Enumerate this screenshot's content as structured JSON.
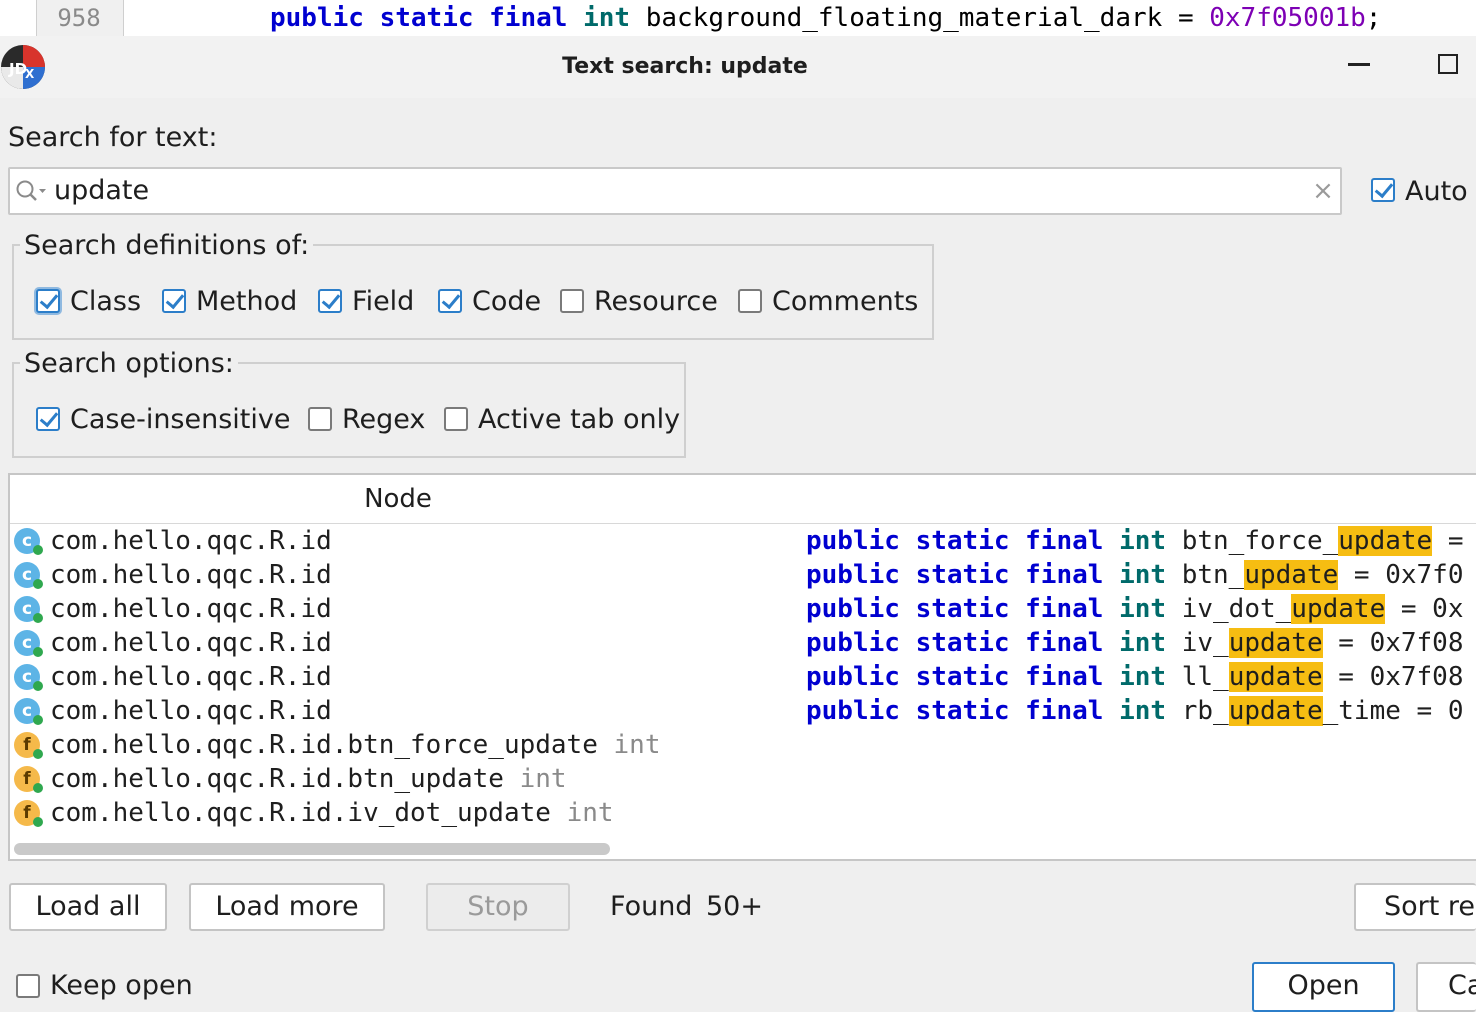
{
  "background_editor": {
    "line_number": "958",
    "code": {
      "kw1": "public",
      "kw2": "static",
      "kw3": "final",
      "type": "int",
      "name": "background_floating_material_dark",
      "eq": "=",
      "value": "0x7f05001b",
      "semi": ";"
    }
  },
  "window": {
    "title": "Text search: update"
  },
  "search": {
    "label": "Search for text:",
    "value": "update",
    "clear_glyph": "×",
    "auto_search_label": "Auto s",
    "auto_search_checked": true
  },
  "definitions": {
    "legend": "Search definitions of:",
    "items": [
      {
        "label": "Class",
        "checked": true
      },
      {
        "label": "Method",
        "checked": true
      },
      {
        "label": "Field",
        "checked": true
      },
      {
        "label": "Code",
        "checked": true
      },
      {
        "label": "Resource",
        "checked": false
      },
      {
        "label": "Comments",
        "checked": false
      }
    ]
  },
  "options": {
    "legend": "Search options:",
    "items": [
      {
        "label": "Case-insensitive",
        "checked": true
      },
      {
        "label": "Regex",
        "checked": false
      },
      {
        "label": "Active tab only",
        "checked": false
      }
    ]
  },
  "results": {
    "columns": [
      "Node",
      ""
    ],
    "rows": [
      {
        "icon": "class-icon",
        "letter": "c",
        "node": "com.hello.qqc.R.id",
        "type": "",
        "code": {
          "pre": "btn_force_",
          "match": "update",
          "post": " ="
        }
      },
      {
        "icon": "class-icon",
        "letter": "c",
        "node": "com.hello.qqc.R.id",
        "type": "",
        "code": {
          "pre": "btn_",
          "match": "update",
          "post": " = 0x7f0"
        }
      },
      {
        "icon": "class-icon",
        "letter": "c",
        "node": "com.hello.qqc.R.id",
        "type": "",
        "code": {
          "pre": "iv_dot_",
          "match": "update",
          "post": " = 0x"
        }
      },
      {
        "icon": "class-icon",
        "letter": "c",
        "node": "com.hello.qqc.R.id",
        "type": "",
        "code": {
          "pre": "iv_",
          "match": "update",
          "post": " = 0x7f08"
        }
      },
      {
        "icon": "class-icon",
        "letter": "c",
        "node": "com.hello.qqc.R.id",
        "type": "",
        "code": {
          "pre": "ll_",
          "match": "update",
          "post": " = 0x7f08"
        }
      },
      {
        "icon": "class-icon",
        "letter": "c",
        "node": "com.hello.qqc.R.id",
        "type": "",
        "code": {
          "pre": "rb_",
          "match": "update",
          "post": "_time = 0"
        }
      },
      {
        "icon": "field-icon",
        "letter": "f",
        "node": "com.hello.qqc.R.id.btn_force_update",
        "type": "int",
        "code": null
      },
      {
        "icon": "field-icon",
        "letter": "f",
        "node": "com.hello.qqc.R.id.btn_update",
        "type": "int",
        "code": null
      },
      {
        "icon": "field-icon",
        "letter": "f",
        "node": "com.hello.qqc.R.id.iv_dot_update",
        "type": "int",
        "code": null
      }
    ],
    "code_prefix": {
      "kw1": "public",
      "kw2": "static",
      "kw3": "final",
      "type": "int"
    }
  },
  "actions": {
    "load_all": "Load all",
    "load_more": "Load more",
    "stop": "Stop",
    "found_label": "Found",
    "found_count": "50+",
    "sort": "Sort res",
    "keep_open": "Keep open",
    "keep_open_checked": false,
    "open": "Open",
    "cancel": "Ca"
  }
}
